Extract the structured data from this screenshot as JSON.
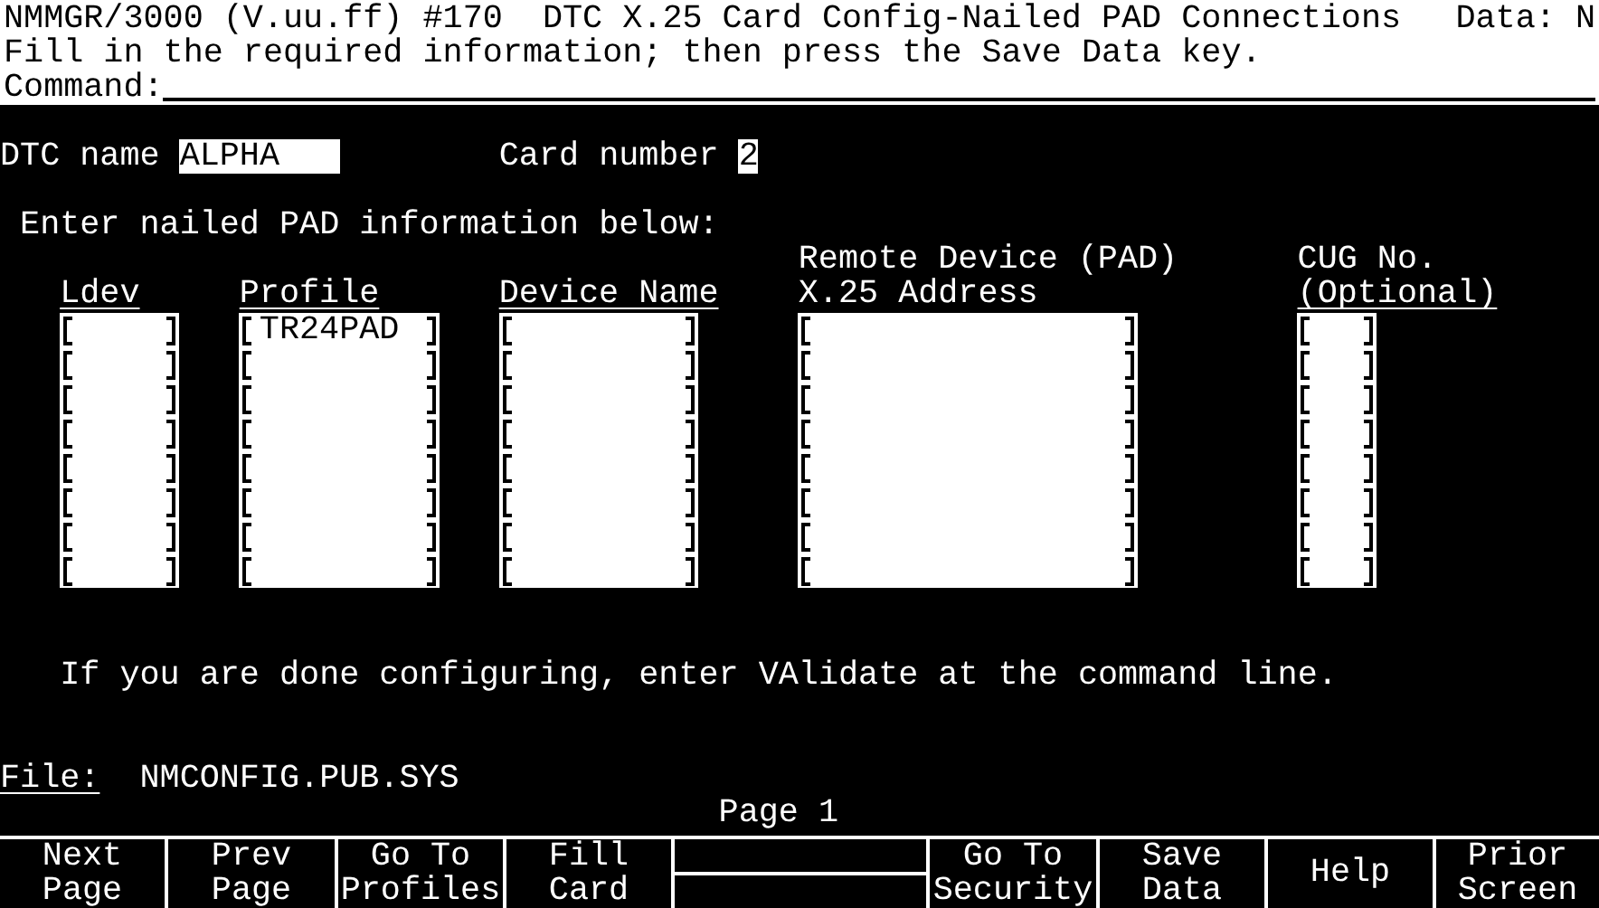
{
  "header": {
    "title": "NMMGR/3000 (V.uu.ff) #170  DTC X.25 Card Config-Nailed PAD Connections",
    "data_flag": "Data: N",
    "message": "Fill in the required information; then press the Save Data key.",
    "command_label": "Command:"
  },
  "dtc_name": {
    "label": "DTC name",
    "value": "ALPHA"
  },
  "card_number": {
    "label": "Card number",
    "value": "2"
  },
  "instructions": "Enter nailed PAD information below:",
  "table": {
    "columns": [
      {
        "heading": [
          "Ldev"
        ],
        "underlined": true
      },
      {
        "heading": [
          "Profile"
        ],
        "underlined": true
      },
      {
        "heading": [
          "Device Name"
        ],
        "underlined": true
      },
      {
        "heading": [
          "Remote Device (PAD)",
          "X.25 Address"
        ],
        "underlined": false
      },
      {
        "heading": [
          "CUG No.",
          "(Optional)"
        ],
        "underlined": true
      }
    ],
    "rows": [
      {
        "column_2": "TR24PAD"
      },
      {},
      {},
      {},
      {},
      {},
      {},
      {}
    ]
  },
  "note": "If you are done configuring, enter VAlidate at the command line.",
  "file": {
    "label": "File:",
    "value": "NMCONFIG.PUB.SYS"
  },
  "page": "Page 1",
  "function_keys": [
    {
      "kind": "label",
      "lines": [
        "Next",
        "Page"
      ]
    },
    {
      "kind": "label",
      "lines": [
        "Prev",
        "Page"
      ]
    },
    {
      "kind": "label",
      "lines": [
        "Go To",
        "Profiles"
      ]
    },
    {
      "kind": "label",
      "lines": [
        "Fill",
        "Card"
      ]
    },
    {
      "kind": "blank"
    },
    {
      "kind": "label",
      "lines": [
        "Go To",
        "Security"
      ]
    },
    {
      "kind": "label",
      "lines": [
        "Save",
        "Data"
      ]
    },
    {
      "kind": "label",
      "lines": [
        "Help"
      ]
    },
    {
      "kind": "label",
      "lines": [
        "Prior",
        "Screen"
      ]
    }
  ]
}
